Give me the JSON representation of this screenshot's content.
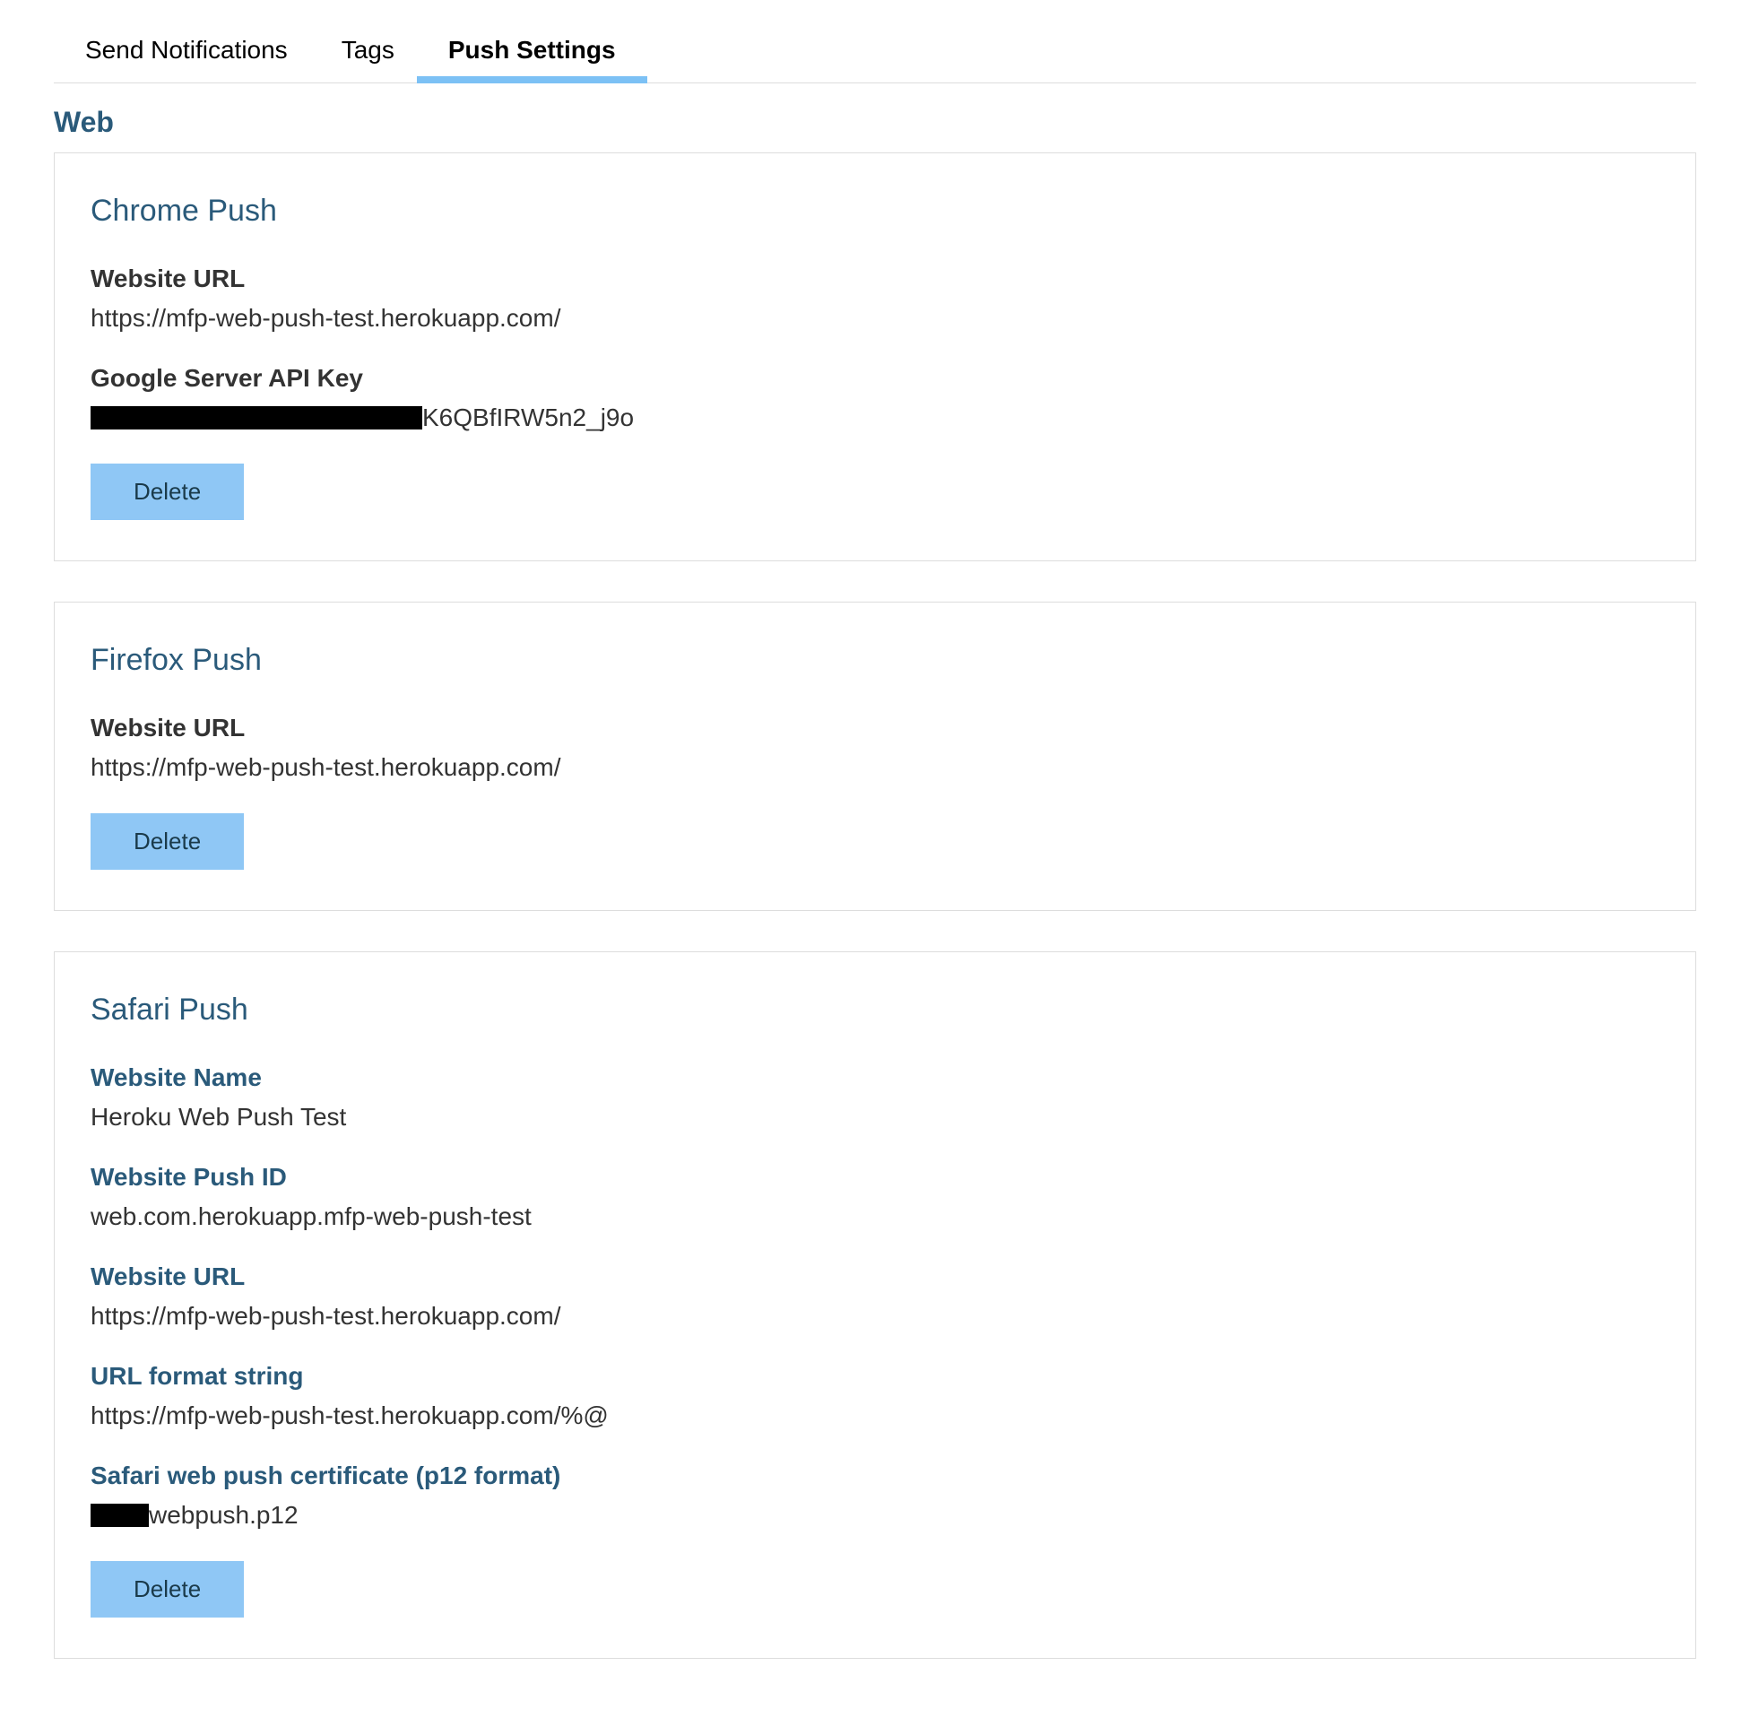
{
  "tabs": {
    "send_notifications": "Send Notifications",
    "tags": "Tags",
    "push_settings": "Push Settings"
  },
  "section": {
    "web": "Web"
  },
  "chrome": {
    "title": "Chrome Push",
    "website_url_label": "Website URL",
    "website_url_value": "https://mfp-web-push-test.herokuapp.com/",
    "api_key_label": "Google Server API Key",
    "api_key_suffix": "K6QBfIRW5n2_j9o",
    "delete": "Delete"
  },
  "firefox": {
    "title": "Firefox Push",
    "website_url_label": "Website URL",
    "website_url_value": "https://mfp-web-push-test.herokuapp.com/",
    "delete": "Delete"
  },
  "safari": {
    "title": "Safari Push",
    "website_name_label": "Website Name",
    "website_name_value": "Heroku Web Push Test",
    "website_push_id_label": "Website Push ID",
    "website_push_id_value": "web.com.herokuapp.mfp-web-push-test",
    "website_url_label": "Website URL",
    "website_url_value": "https://mfp-web-push-test.herokuapp.com/",
    "url_format_label": "URL format string",
    "url_format_value": "https://mfp-web-push-test.herokuapp.com/%@",
    "cert_label": "Safari web push certificate (p12 format)",
    "cert_suffix": "webpush.p12",
    "delete": "Delete"
  }
}
